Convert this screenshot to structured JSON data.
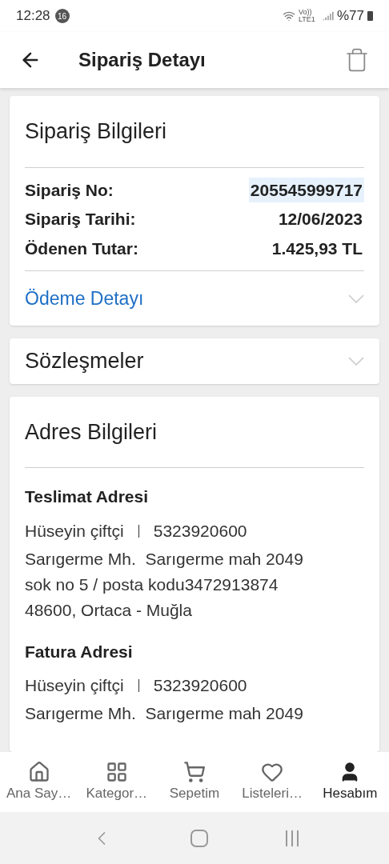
{
  "status_bar": {
    "time": "12:28",
    "notification_count": "16",
    "network": "Vo)) LTE1",
    "battery": "%77"
  },
  "header": {
    "title": "Sipariş Detayı"
  },
  "order_info": {
    "title": "Sipariş Bilgileri",
    "rows": [
      {
        "label": "Sipariş No:",
        "value": "205545999717",
        "highlighted": true
      },
      {
        "label": "Sipariş Tarihi:",
        "value": "12/06/2023",
        "highlighted": false
      },
      {
        "label": "Ödenen Tutar:",
        "value": "1.425,93 TL",
        "highlighted": false
      }
    ],
    "payment_detail": {
      "label": "Ödeme Detayı",
      "expanded": false
    }
  },
  "contracts": {
    "title": "Sözleşmeler",
    "expanded": false
  },
  "address_info": {
    "title": "Adres Bilgileri",
    "addresses": [
      {
        "title": "Teslimat Adresi",
        "name": "Hüseyin çiftçi",
        "phone": "5323920600",
        "lines": [
          "Sarıgerme Mh.  Sarıgerme mah 2049",
          "sok no 5 / posta kodu3472913874",
          "48600, Ortaca - Muğla"
        ]
      },
      {
        "title": "Fatura Adresi",
        "name": "Hüseyin çiftçi",
        "phone": "5323920600",
        "lines": [
          "Sarıgerme Mh.  Sarıgerme mah 2049"
        ]
      }
    ]
  },
  "bottom_nav": [
    {
      "kind": "home",
      "label": "Ana Say…",
      "selected": false
    },
    {
      "kind": "grid",
      "label": "Kategor…",
      "selected": false
    },
    {
      "kind": "cart",
      "label": "Sepetim",
      "selected": false
    },
    {
      "kind": "heart",
      "label": "Listeleri…",
      "selected": false
    },
    {
      "kind": "user",
      "label": "Hesabım",
      "selected": true
    }
  ]
}
